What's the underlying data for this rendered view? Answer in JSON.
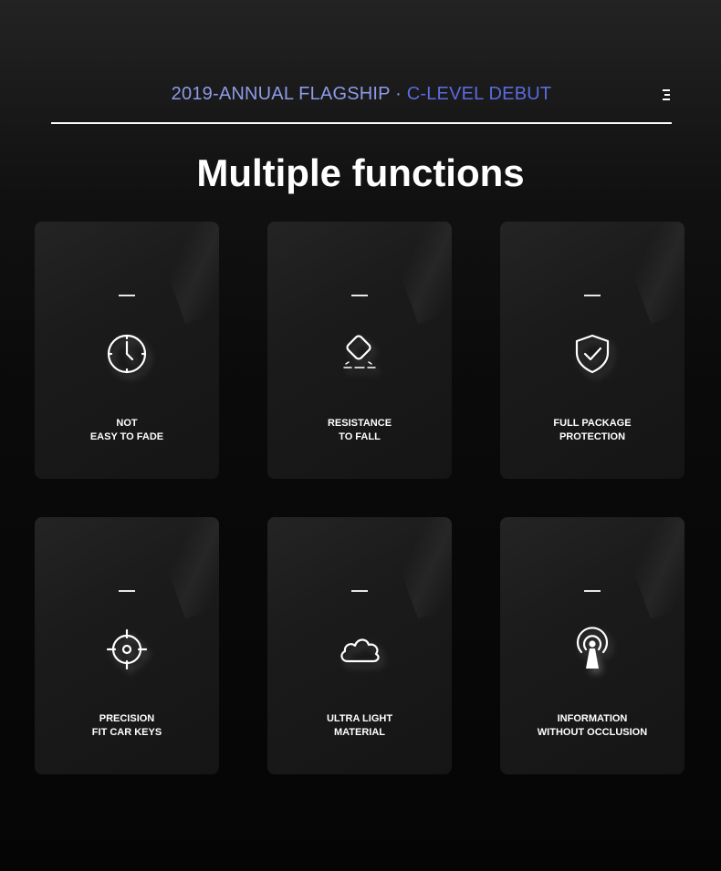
{
  "header": {
    "tagline_left": "2019-ANNUAL FLAGSHIP",
    "tagline_sep": "·",
    "tagline_right": "C-LEVEL DEBUT"
  },
  "page_title": "Multiple functions",
  "features": [
    {
      "line1": "NOT",
      "line2": "EASY TO FADE",
      "icon": "clock-icon"
    },
    {
      "line1": "RESISTANCE",
      "line2": "TO FALL",
      "icon": "drop-impact-icon"
    },
    {
      "line1": "FULL PACKAGE",
      "line2": "PROTECTION",
      "icon": "shield-check-icon"
    },
    {
      "line1": "PRECISION",
      "line2": "FIT CAR KEYS",
      "icon": "crosshair-icon"
    },
    {
      "line1": "ULTRA LIGHT",
      "line2": "MATERIAL",
      "icon": "cloud-icon"
    },
    {
      "line1": "INFORMATION",
      "line2": "WITHOUT OCCLUSION",
      "icon": "signal-tower-icon"
    }
  ],
  "colors": {
    "tagline_left": "#8e9be8",
    "tagline_right": "#5b6be0",
    "card_bg": "#1b1b1b"
  }
}
